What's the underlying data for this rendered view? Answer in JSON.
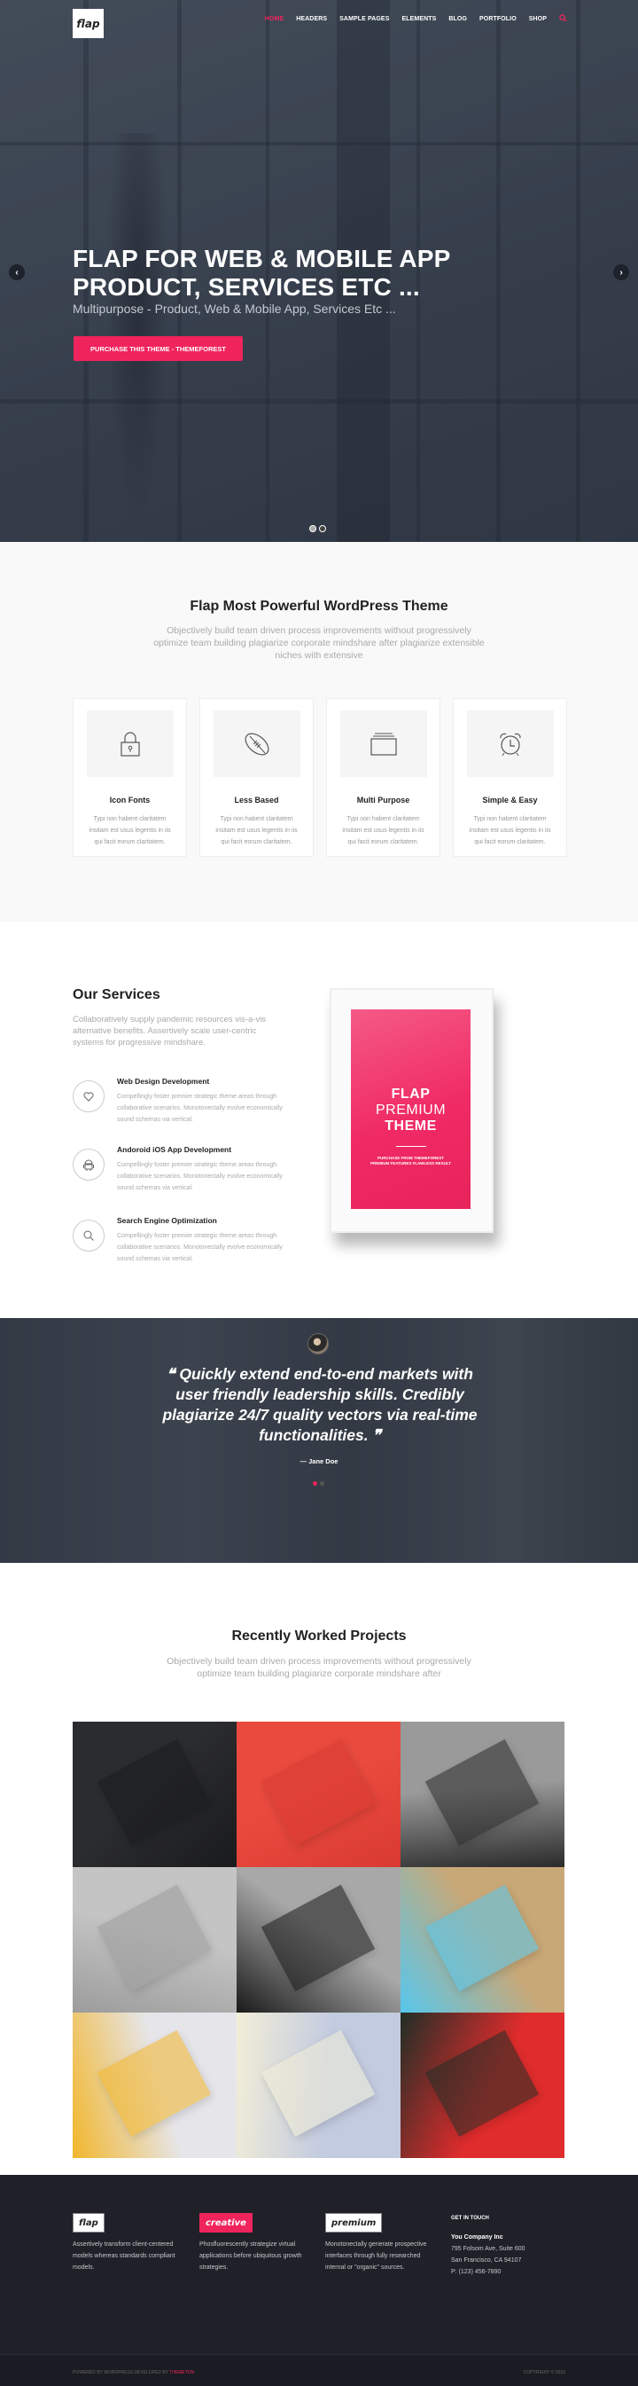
{
  "brand": {
    "accent": "#f0245c",
    "logo_text": "flap"
  },
  "nav": {
    "items": [
      "HOME",
      "HEADERS",
      "SAMPLE PAGES",
      "ELEMENTS",
      "BLOG",
      "PORTFOLIO",
      "SHOP"
    ],
    "active_index": 0,
    "search_icon": "search-icon"
  },
  "hero": {
    "title_line1": "FLAP FOR WEB & MOBILE APP",
    "title_line2": "PRODUCT, SERVICES ETC ...",
    "subtitle": "Multipurpose - Product, Web & Mobile App, Services Etc ...",
    "cta_label": "PURCHASE THIS THEME - THEMEFOREST",
    "prev_icon": "chevron-left-icon",
    "next_icon": "chevron-right-icon",
    "slides": 2,
    "active_slide": 1
  },
  "features": {
    "title": "Flap Most Powerful WordPress Theme",
    "description": "Objectively build team driven process improvements without progressively optimize team building plagiarize corporate mindshare after plagiarize extensible niches with extensive",
    "cards": [
      {
        "icon": "lock-icon",
        "title": "Icon Fonts",
        "text": "Typi non habent claritatem insitam est usus legentis in iis qui facit eorum claritatem."
      },
      {
        "icon": "football-icon",
        "title": "Less Based",
        "text": "Typi non habent claritatem insitam est usus legentis in iis qui facit eorum claritatem."
      },
      {
        "icon": "folders-icon",
        "title": "Multi Purpose",
        "text": "Typi non habent claritatem insitam est usus legentis in iis qui facit eorum claritatem."
      },
      {
        "icon": "alarm-clock-icon",
        "title": "Simple & Easy",
        "text": "Typi non habent claritatem insitam est usus legentis in iis qui facit eorum claritatem."
      }
    ]
  },
  "services": {
    "title": "Our Services",
    "intro": "Collaboratively supply pandemic resources vis-a-vis alternative benefits. Assertively scale user-centric systems for progressive mindshare.",
    "items": [
      {
        "icon": "heart-icon",
        "title": "Web Design Development",
        "text": "Compellingly foster premier strategic theme areas through collaborative scenarios. Monotonectally evolve economically sound schemas via vertical."
      },
      {
        "icon": "android-icon",
        "title": "Andoroid iOS App Development",
        "text": "Compellingly foster premier strategic theme areas through collaborative scenarios. Monotonectally evolve economically sound schemas via vertical."
      },
      {
        "icon": "search-icon",
        "title": "Search Engine Optimization",
        "text": "Compellingly foster premier strategic theme areas through collaborative scenarios. Monotonectally evolve economically sound schemas via vertical."
      }
    ],
    "poster": {
      "line1": "FLAP",
      "line2": "PREMIUM",
      "line3": "THEME",
      "small1": "PURCHASE FROM THEMEFOREST",
      "small2": "PREMIUM FEATURES FLAWLESS RESULT"
    }
  },
  "testimonial": {
    "quote": "Quickly extend end-to-end markets with user friendly leadership skills. Credibly plagiarize 24/7 quality vectors via real-time functionalities.",
    "open_quote": "❝",
    "close_quote": "❞",
    "author": "— Jane Doe",
    "slides": 2,
    "active_slide": 1
  },
  "projects": {
    "title": "Recently Worked Projects",
    "description": "Objectively build team driven process improvements without progressively optimize team building plagiarize corporate mindshare after",
    "tiles": [
      {
        "name": "black-stationery",
        "colors": [
          "#2b2c2f",
          "#1a1b1d"
        ]
      },
      {
        "name": "red-typography",
        "colors": [
          "#ea4a3e",
          "#d93a30"
        ]
      },
      {
        "name": "architektur-design",
        "colors": [
          "#9a9a9a",
          "#2b2b2b"
        ]
      },
      {
        "name": "white-letterhead",
        "colors": [
          "#c4c4c4",
          "#9c9c9c"
        ]
      },
      {
        "name": "black-white-cards",
        "colors": [
          "#a8a8a8",
          "#1a1a1a"
        ]
      },
      {
        "name": "blue-herr-print",
        "colors": [
          "#c9a877",
          "#56c7ee"
        ]
      },
      {
        "name": "yellow-notebook",
        "colors": [
          "#e6e6ea",
          "#f2b62c"
        ]
      },
      {
        "name": "open-dotted-book",
        "colors": [
          "#c3cbe0",
          "#f2eed7"
        ]
      },
      {
        "name": "red-fanned-book",
        "colors": [
          "#e02c2c",
          "#1f2e26"
        ]
      }
    ]
  },
  "footer": {
    "columns": [
      {
        "badge": "flap",
        "style": "white",
        "text": "Assertively transform client-centered models whereas standards compliant models."
      },
      {
        "badge": "creative",
        "style": "pink",
        "text": "Phosfluorescently strategize virtual applications before ubiquitous growth strategies."
      },
      {
        "badge": "premium",
        "style": "white",
        "text": "Monotonectally generate prospective interfaces through fully researched internal or \"organic\" sources."
      }
    ],
    "contact": {
      "heading": "GET IN TOUCH",
      "company": "You Company Inc",
      "address1": "795 Folsom Ave, Suite 600",
      "address2": "San Francisco, CA 94107",
      "phone": "P: (123) 456-7890"
    },
    "bottom_left": "POWERED BY WORDPRESS DEVELOPED BY",
    "bottom_left_link": "THEMETON",
    "bottom_right": "COPYRIGHT © 2016"
  }
}
